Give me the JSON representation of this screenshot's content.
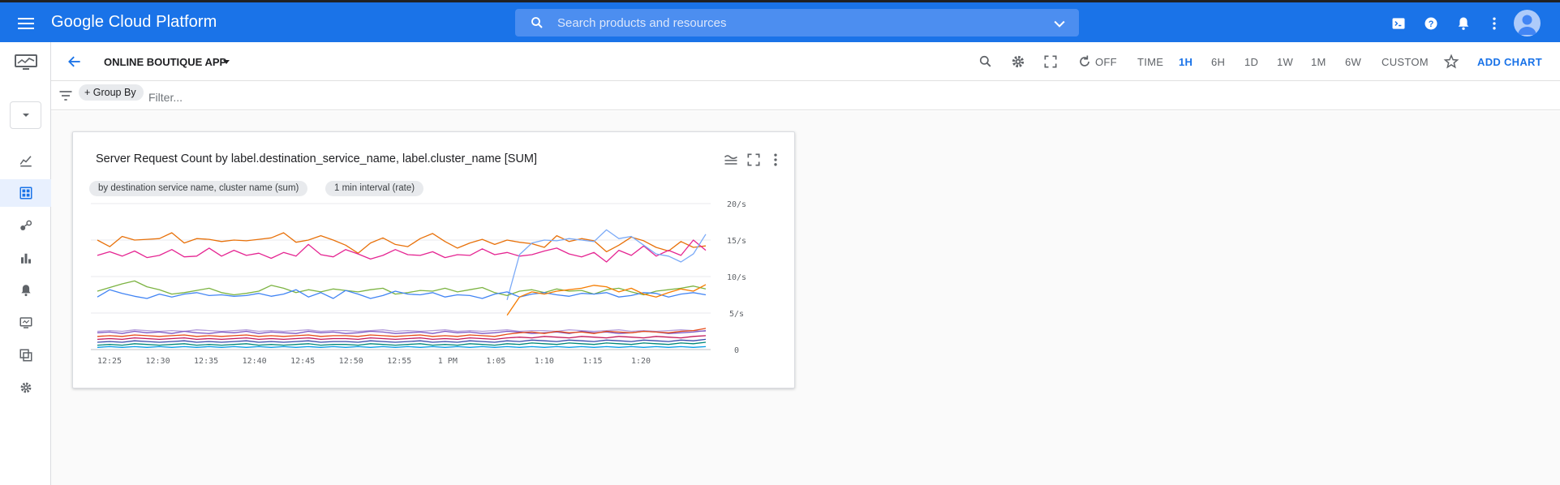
{
  "header": {
    "brand": "Google Cloud Platform",
    "search_placeholder": "Search products and resources"
  },
  "icons": {
    "menu": "menu-icon",
    "search": "search-icon",
    "terminal": "cloud-shell-icon",
    "help": "help-icon",
    "notifications": "bell-icon",
    "more": "more-vert-icon",
    "account": "account-avatar"
  },
  "toolbar": {
    "dashboard_name": "ONLINE BOUTIQUE APP",
    "auto_refresh": "OFF",
    "time_label": "TIME",
    "ranges": [
      "1H",
      "6H",
      "1D",
      "1W",
      "1M",
      "6W",
      "CUSTOM"
    ],
    "selected_range": "1H",
    "add_chart": "ADD CHART"
  },
  "filterbar": {
    "group_by": "+ Group By",
    "filter_placeholder": "Filter..."
  },
  "colors": {
    "header_blue": "#1a73e8",
    "accent": "#1a73e8"
  },
  "card": {
    "title": "Server Request Count by label.destination_service_name, label.cluster_name [SUM]",
    "chips": [
      "by destination service name, cluster name (sum)",
      "1 min interval (rate)"
    ]
  },
  "chart_data": {
    "type": "line",
    "title": "Server Request Count by label.destination_service_name, label.cluster_name [SUM]",
    "xlabel": "",
    "ylabel": "",
    "x_ticks": [
      "12:25",
      "12:30",
      "12:35",
      "12:40",
      "12:45",
      "12:50",
      "12:55",
      "1 PM",
      "1:05",
      "1:10",
      "1:15",
      "1:20"
    ],
    "y_ticks": [
      "0",
      "5/s",
      "10/s",
      "15/s",
      "20/s"
    ],
    "ylim": [
      0,
      20
    ],
    "grid": true,
    "legend": "none",
    "series": [
      {
        "color": "#e8710a",
        "values": [
          15.0,
          14.1,
          15.5,
          15.0,
          15.1,
          15.2,
          16.0,
          14.6,
          15.2,
          15.1,
          14.8,
          15.0,
          14.9,
          15.1,
          15.3,
          16.0,
          14.7,
          15.0,
          15.6,
          15.0,
          14.3,
          13.2,
          14.6,
          15.3,
          14.4,
          14.1,
          15.2,
          15.9,
          14.8,
          13.9,
          14.6,
          15.1,
          14.4,
          15.0,
          14.7,
          14.5,
          14.0,
          15.6,
          14.8,
          15.2,
          14.9,
          13.4,
          14.3,
          15.4,
          14.9,
          14.0,
          13.5,
          14.8,
          14.0,
          14.2
        ]
      },
      {
        "color": "#e52592",
        "values": [
          12.9,
          13.4,
          12.8,
          13.5,
          12.6,
          12.9,
          13.7,
          12.7,
          12.8,
          13.9,
          12.8,
          13.6,
          12.9,
          13.2,
          12.5,
          13.3,
          12.8,
          14.4,
          13.0,
          12.7,
          13.7,
          13.1,
          12.4,
          12.9,
          13.7,
          13.0,
          12.9,
          13.4,
          12.6,
          13.0,
          12.9,
          13.8,
          13.0,
          13.3,
          12.8,
          13.0,
          13.5,
          13.9,
          13.1,
          12.7,
          13.3,
          12.0,
          13.6,
          12.9,
          14.2,
          12.8,
          13.6,
          12.9,
          15.0,
          13.6
        ]
      },
      {
        "color": "#7baaf7",
        "values": [
          null,
          null,
          null,
          null,
          null,
          null,
          null,
          null,
          null,
          null,
          null,
          null,
          null,
          null,
          null,
          null,
          null,
          null,
          null,
          null,
          null,
          null,
          null,
          null,
          null,
          null,
          null,
          null,
          null,
          null,
          null,
          null,
          null,
          6.8,
          13.0,
          14.6,
          15.0,
          14.9,
          15.2,
          15.0,
          14.8,
          16.4,
          15.2,
          15.5,
          14.3,
          13.1,
          12.8,
          12.0,
          13.1,
          15.8
        ]
      },
      {
        "color": "#7cb342",
        "values": [
          8.0,
          8.5,
          9.0,
          9.4,
          8.6,
          8.2,
          7.6,
          7.8,
          8.1,
          8.4,
          7.8,
          7.5,
          7.7,
          8.0,
          8.8,
          8.4,
          7.8,
          8.2,
          7.9,
          8.3,
          8.1,
          7.9,
          8.2,
          8.4,
          7.6,
          7.8,
          8.1,
          8.0,
          8.4,
          7.9,
          8.2,
          8.5,
          7.8,
          7.4,
          8.0,
          8.2,
          7.8,
          8.3,
          8.0,
          8.1,
          7.6,
          8.2,
          8.4,
          7.9,
          7.5,
          8.0,
          8.2,
          8.4,
          8.7,
          8.3
        ]
      },
      {
        "color": "#4285f4",
        "values": [
          7.2,
          8.2,
          7.7,
          7.3,
          7.0,
          7.6,
          7.2,
          7.6,
          7.8,
          7.4,
          7.5,
          7.3,
          7.4,
          7.7,
          7.3,
          7.6,
          8.2,
          7.2,
          7.8,
          7.0,
          8.1,
          7.6,
          7.0,
          7.4,
          8.0,
          7.6,
          7.5,
          7.8,
          7.2,
          7.5,
          7.4,
          7.0,
          7.6,
          7.9,
          7.2,
          7.6,
          7.8,
          7.5,
          7.3,
          7.7,
          7.6,
          7.8,
          7.2,
          7.4,
          7.8,
          7.7,
          7.2,
          7.6,
          7.8,
          7.5
        ]
      },
      {
        "color": "#f57c00",
        "values": [
          null,
          null,
          null,
          null,
          null,
          null,
          null,
          null,
          null,
          null,
          null,
          null,
          null,
          null,
          null,
          null,
          null,
          null,
          null,
          null,
          null,
          null,
          null,
          null,
          null,
          null,
          null,
          null,
          null,
          null,
          null,
          null,
          null,
          4.7,
          7.2,
          7.9,
          7.6,
          8.0,
          8.2,
          8.4,
          8.8,
          8.6,
          7.9,
          8.4,
          7.6,
          7.2,
          7.8,
          8.3,
          8.0,
          8.9
        ]
      },
      {
        "color": "#b39ddb",
        "values": [
          2.5,
          2.6,
          2.5,
          2.7,
          2.6,
          2.5,
          2.6,
          2.5,
          2.7,
          2.6,
          2.5,
          2.6,
          2.7,
          2.5,
          2.6,
          2.5,
          2.6,
          2.7,
          2.5,
          2.6,
          2.6,
          2.5,
          2.6,
          2.7,
          2.5,
          2.6,
          2.5,
          2.6,
          2.7,
          2.5,
          2.6,
          2.5,
          2.6,
          2.7,
          2.5,
          2.6,
          2.6,
          2.5,
          2.7,
          2.6,
          2.5,
          2.6,
          2.7,
          2.5,
          2.6,
          2.5,
          2.6,
          2.7,
          2.6,
          2.5
        ]
      },
      {
        "color": "#7e57c2",
        "values": [
          2.3,
          2.4,
          2.2,
          2.5,
          2.3,
          2.4,
          2.2,
          2.5,
          2.3,
          2.2,
          2.4,
          2.3,
          2.5,
          2.2,
          2.4,
          2.3,
          2.2,
          2.5,
          2.3,
          2.4,
          2.2,
          2.3,
          2.5,
          2.4,
          2.2,
          2.3,
          2.4,
          2.2,
          2.5,
          2.3,
          2.4,
          2.2,
          2.3,
          2.5,
          2.4,
          2.2,
          2.3,
          2.4,
          2.2,
          2.5,
          2.3,
          2.4,
          2.2,
          2.3,
          2.5,
          2.4,
          2.2,
          2.3,
          2.4,
          2.6
        ]
      },
      {
        "color": "#e64a19",
        "values": [
          1.8,
          1.9,
          1.8,
          2.0,
          1.9,
          1.8,
          1.9,
          2.0,
          1.8,
          1.9,
          1.8,
          1.9,
          2.0,
          1.8,
          1.9,
          1.8,
          1.9,
          2.0,
          1.8,
          1.9,
          1.9,
          1.8,
          2.0,
          1.9,
          1.8,
          1.9,
          2.0,
          1.8,
          1.9,
          1.8,
          2.0,
          1.9,
          1.8,
          2.1,
          2.3,
          2.4,
          2.2,
          2.5,
          2.3,
          2.4,
          2.2,
          2.5,
          2.4,
          2.3,
          2.5,
          2.4,
          2.3,
          2.5,
          2.6,
          2.9
        ]
      },
      {
        "color": "#c2185b",
        "values": [
          1.4,
          1.5,
          1.4,
          1.6,
          1.5,
          1.4,
          1.5,
          1.6,
          1.4,
          1.5,
          1.4,
          1.5,
          1.6,
          1.4,
          1.5,
          1.4,
          1.5,
          1.6,
          1.4,
          1.5,
          1.5,
          1.4,
          1.6,
          1.5,
          1.4,
          1.5,
          1.6,
          1.4,
          1.5,
          1.4,
          1.6,
          1.5,
          1.4,
          1.6,
          1.7,
          1.6,
          1.8,
          1.7,
          1.6,
          1.8,
          1.7,
          1.6,
          1.8,
          1.7,
          1.6,
          1.8,
          1.7,
          1.6,
          1.8,
          1.9
        ]
      },
      {
        "color": "#3949ab",
        "values": [
          1.0,
          1.1,
          1.0,
          1.2,
          1.1,
          1.0,
          1.1,
          1.2,
          1.0,
          1.1,
          1.0,
          1.1,
          1.2,
          1.0,
          1.1,
          1.0,
          1.1,
          1.2,
          1.0,
          1.1,
          1.1,
          1.0,
          1.2,
          1.1,
          1.0,
          1.1,
          1.2,
          1.0,
          1.1,
          1.0,
          1.2,
          1.1,
          1.0,
          1.2,
          1.1,
          1.3,
          1.2,
          1.1,
          1.3,
          1.2,
          1.1,
          1.3,
          1.2,
          1.1,
          1.3,
          1.2,
          1.1,
          1.3,
          1.2,
          1.4
        ]
      },
      {
        "color": "#00897b",
        "values": [
          0.6,
          0.7,
          0.6,
          0.8,
          0.7,
          0.6,
          0.7,
          0.8,
          0.6,
          0.7,
          0.6,
          0.7,
          0.8,
          0.6,
          0.7,
          0.6,
          0.7,
          0.8,
          0.6,
          0.7,
          0.7,
          0.6,
          0.8,
          0.7,
          0.6,
          0.7,
          0.8,
          0.6,
          0.7,
          0.6,
          0.8,
          0.7,
          0.6,
          0.8,
          0.7,
          0.9,
          0.8,
          0.7,
          0.9,
          0.8,
          0.7,
          0.9,
          0.8,
          0.7,
          0.9,
          0.8,
          0.7,
          0.9,
          0.8,
          1.0
        ]
      },
      {
        "color": "#039be5",
        "values": [
          0.3,
          0.4,
          0.3,
          0.4,
          0.3,
          0.4,
          0.3,
          0.4,
          0.3,
          0.4,
          0.3,
          0.4,
          0.3,
          0.4,
          0.3,
          0.4,
          0.3,
          0.4,
          0.3,
          0.4,
          0.3,
          0.4,
          0.3,
          0.4,
          0.3,
          0.4,
          0.3,
          0.4,
          0.3,
          0.4,
          0.3,
          0.4,
          0.3,
          0.4,
          0.3,
          0.4,
          0.3,
          0.4,
          0.3,
          0.4,
          0.3,
          0.4,
          0.3,
          0.4,
          0.3,
          0.4,
          0.3,
          0.4,
          0.3,
          0.4
        ]
      }
    ]
  }
}
